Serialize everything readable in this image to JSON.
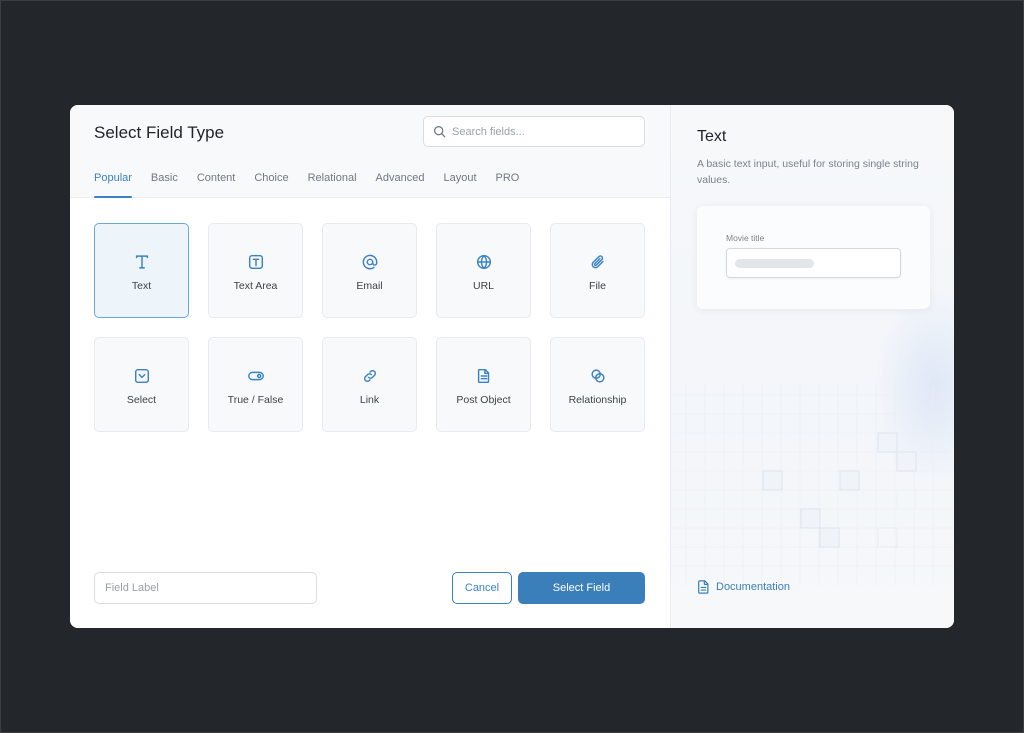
{
  "dialog": {
    "title": "Select Field Type",
    "search": {
      "placeholder": "Search fields...",
      "value": ""
    },
    "tabs": [
      {
        "label": "Popular",
        "active": true
      },
      {
        "label": "Basic",
        "active": false
      },
      {
        "label": "Content",
        "active": false
      },
      {
        "label": "Choice",
        "active": false
      },
      {
        "label": "Relational",
        "active": false
      },
      {
        "label": "Advanced",
        "active": false
      },
      {
        "label": "Layout",
        "active": false
      },
      {
        "label": "PRO",
        "active": false
      }
    ],
    "field_types": [
      {
        "label": "Text",
        "icon": "text-icon",
        "selected": true
      },
      {
        "label": "Text Area",
        "icon": "text-area-icon",
        "selected": false
      },
      {
        "label": "Email",
        "icon": "at-sign-icon",
        "selected": false
      },
      {
        "label": "URL",
        "icon": "globe-icon",
        "selected": false
      },
      {
        "label": "File",
        "icon": "paperclip-icon",
        "selected": false
      },
      {
        "label": "Select",
        "icon": "select-dropdown-icon",
        "selected": false
      },
      {
        "label": "True / False",
        "icon": "toggle-icon",
        "selected": false
      },
      {
        "label": "Link",
        "icon": "link-icon",
        "selected": false
      },
      {
        "label": "Post Object",
        "icon": "document-icon",
        "selected": false
      },
      {
        "label": "Relationship",
        "icon": "relationship-icon",
        "selected": false
      }
    ],
    "footer": {
      "field_label_placeholder": "Field Label",
      "field_label_value": "",
      "cancel_label": "Cancel",
      "select_label": "Select Field"
    }
  },
  "sidebar": {
    "title": "Text",
    "description": "A basic text input, useful for storing single string values.",
    "preview_label": "Movie title",
    "documentation_label": "Documentation"
  },
  "colors": {
    "accent": "#3b82c4",
    "primary_button": "#3b7fba",
    "background": "#23262b"
  }
}
